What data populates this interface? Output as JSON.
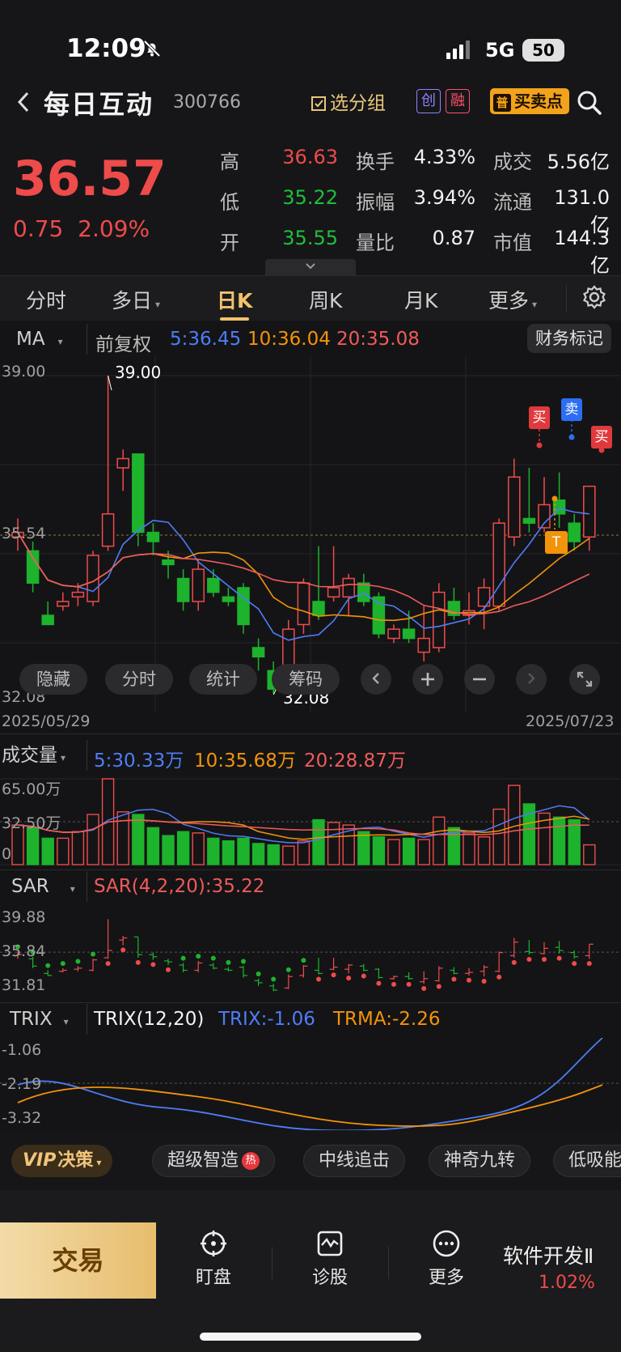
{
  "status_bar": {
    "time": "12:09",
    "network": "5G",
    "battery": "50"
  },
  "header": {
    "back_icon": "chevron-left-icon",
    "stock_name": "每日互动",
    "stock_code": "300766",
    "group_label": "选分组",
    "tag_chuang": "创",
    "tag_rong": "融",
    "buysell_prefix": "普",
    "buysell_label": "买卖点"
  },
  "quote": {
    "price": "36.57",
    "change": "0.75",
    "change_pct": "2.09%",
    "rows": [
      {
        "l1": "高",
        "v1": "36.63",
        "c1": "#ee4b4b",
        "l2": "换手",
        "v2": "4.33%",
        "l3": "成交",
        "v3": "5.56亿"
      },
      {
        "l1": "低",
        "v1": "35.22",
        "c1": "#1fbf3a",
        "l2": "振幅",
        "v2": "3.94%",
        "l3": "流通",
        "v3": "131.0亿"
      },
      {
        "l1": "开",
        "v1": "35.55",
        "c1": "#1fbf3a",
        "l2": "量比",
        "v2": "0.87",
        "l3": "市值",
        "v3": "144.3亿"
      }
    ]
  },
  "period_tabs": [
    "分时",
    "多日",
    "日K",
    "周K",
    "月K",
    "更多"
  ],
  "active_tab": "日K",
  "kline": {
    "indicator": "MA",
    "adjust": "前复权",
    "ma5": "5:36.45",
    "ma10": "10:36.04",
    "ma20": "20:35.08",
    "finance_mark": "财务标记",
    "y_top": "39.00",
    "y_mid": "35.54",
    "y_bottom": "32.08",
    "max_label": "39.00",
    "min_label": "32.08",
    "date_start": "2025/05/29",
    "date_end": "2025/07/23",
    "buttons": [
      "隐藏",
      "分时",
      "统计",
      "筹码"
    ],
    "signals": {
      "buy1": "买",
      "sell": "卖",
      "buy2": "买",
      "t": "T"
    }
  },
  "volume": {
    "label": "成交量",
    "ma5": "5:30.33万",
    "ma10": "10:35.68万",
    "ma20": "20:28.87万",
    "y_top": "65.00万",
    "y_mid": "32.50万",
    "y_zero": "0"
  },
  "sar": {
    "label": "SAR",
    "value": "SAR(4,2,20):35.22",
    "y_top": "39.88",
    "y_mid": "35.84",
    "y_bottom": "31.81"
  },
  "trix": {
    "label": "TRIX",
    "params": "TRIX(12,20)",
    "trix": "TRIX:-1.06",
    "trma": "TRMA:-2.26",
    "y_top": "-1.06",
    "y_mid": "-2.19",
    "y_bottom": "-3.32"
  },
  "chart_data": {
    "type": "candlestick",
    "ylim": [
      32.08,
      39.0
    ],
    "candles": [
      {
        "o": 35.5,
        "c": 35.6,
        "h": 35.9,
        "l": 35.2
      },
      {
        "o": 35.2,
        "c": 34.5,
        "h": 35.4,
        "l": 34.3
      },
      {
        "o": 33.8,
        "c": 33.6,
        "h": 34.1,
        "l": 33.6
      },
      {
        "o": 34.0,
        "c": 34.1,
        "h": 34.3,
        "l": 33.9
      },
      {
        "o": 34.2,
        "c": 34.3,
        "h": 34.5,
        "l": 34.0
      },
      {
        "o": 34.1,
        "c": 35.1,
        "h": 35.2,
        "l": 34.0
      },
      {
        "o": 35.3,
        "c": 36.0,
        "h": 39.0,
        "l": 35.2
      },
      {
        "o": 37.0,
        "c": 37.2,
        "h": 37.4,
        "l": 36.5
      },
      {
        "o": 37.3,
        "c": 35.6,
        "h": 37.3,
        "l": 35.3
      },
      {
        "o": 35.6,
        "c": 35.4,
        "h": 35.8,
        "l": 35.1
      },
      {
        "o": 35.0,
        "c": 34.9,
        "h": 35.2,
        "l": 34.6
      },
      {
        "o": 34.6,
        "c": 34.1,
        "h": 34.8,
        "l": 33.9
      },
      {
        "o": 34.1,
        "c": 34.8,
        "h": 35.0,
        "l": 33.9
      },
      {
        "o": 34.6,
        "c": 34.3,
        "h": 34.8,
        "l": 34.2
      },
      {
        "o": 34.2,
        "c": 34.1,
        "h": 34.4,
        "l": 34.0
      },
      {
        "o": 34.4,
        "c": 33.6,
        "h": 34.5,
        "l": 33.4
      },
      {
        "o": 33.1,
        "c": 32.9,
        "h": 33.3,
        "l": 32.6
      },
      {
        "o": 32.6,
        "c": 32.2,
        "h": 32.8,
        "l": 32.1
      },
      {
        "o": 32.4,
        "c": 33.5,
        "h": 33.7,
        "l": 32.3
      },
      {
        "o": 33.6,
        "c": 34.5,
        "h": 34.6,
        "l": 33.4
      },
      {
        "o": 34.1,
        "c": 33.8,
        "h": 35.3,
        "l": 33.7
      },
      {
        "o": 34.2,
        "c": 34.4,
        "h": 35.3,
        "l": 34.1
      },
      {
        "o": 34.2,
        "c": 34.6,
        "h": 34.7,
        "l": 33.8
      },
      {
        "o": 34.5,
        "c": 34.1,
        "h": 34.7,
        "l": 34.0
      },
      {
        "o": 34.2,
        "c": 33.4,
        "h": 34.3,
        "l": 33.3
      },
      {
        "o": 33.3,
        "c": 33.5,
        "h": 33.6,
        "l": 33.2
      },
      {
        "o": 33.5,
        "c": 33.3,
        "h": 33.9,
        "l": 33.2
      },
      {
        "o": 33.0,
        "c": 33.3,
        "h": 34.0,
        "l": 32.8
      },
      {
        "o": 33.1,
        "c": 34.3,
        "h": 34.5,
        "l": 33.0
      },
      {
        "o": 34.1,
        "c": 33.8,
        "h": 34.4,
        "l": 33.7
      },
      {
        "o": 33.8,
        "c": 33.9,
        "h": 34.3,
        "l": 33.6
      },
      {
        "o": 34.0,
        "c": 34.4,
        "h": 34.6,
        "l": 33.5
      },
      {
        "o": 34.0,
        "c": 35.8,
        "h": 35.9,
        "l": 33.9
      },
      {
        "o": 35.5,
        "c": 36.8,
        "h": 37.2,
        "l": 35.3
      },
      {
        "o": 35.9,
        "c": 35.8,
        "h": 37.0,
        "l": 35.6
      },
      {
        "o": 35.7,
        "c": 36.2,
        "h": 36.8,
        "l": 35.6
      },
      {
        "o": 36.3,
        "c": 36.0,
        "h": 36.9,
        "l": 35.7
      },
      {
        "o": 35.8,
        "c": 35.4,
        "h": 36.0,
        "l": 35.2
      },
      {
        "o": 35.5,
        "c": 36.6,
        "h": 36.6,
        "l": 35.2
      }
    ],
    "volumes": [
      30,
      28,
      20,
      20,
      25,
      38,
      65,
      40,
      38,
      28,
      22,
      25,
      24,
      20,
      18,
      20,
      16,
      15,
      14,
      18,
      34,
      32,
      30,
      25,
      21,
      19,
      20,
      19,
      36,
      28,
      24,
      21,
      42,
      60,
      46,
      39,
      36,
      34,
      15
    ]
  }
}
